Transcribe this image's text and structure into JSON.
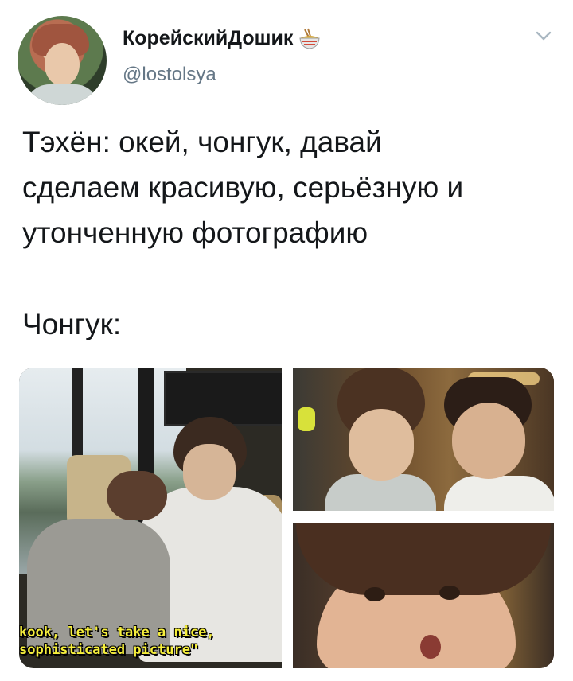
{
  "tweet": {
    "author": {
      "display_name": "КорейскийДошик",
      "handle": "@lostolsya",
      "name_emoji": "noodle-bowl-icon"
    },
    "menu_icon": "chevron-down-icon",
    "text": {
      "line1": "Тэхён: окей, чонгук, давай",
      "line2": "сделаем красивую, серьёзную и",
      "line3": "утонченную фотографию",
      "line4": "Чонгук:"
    },
    "media": {
      "photo1_caption_line1": "kook, let's take a nice,",
      "photo1_caption_line2": "sophisticated picture\""
    }
  },
  "colors": {
    "text": "#14171a",
    "secondary": "#657786",
    "caption": "#f6ef3c"
  }
}
